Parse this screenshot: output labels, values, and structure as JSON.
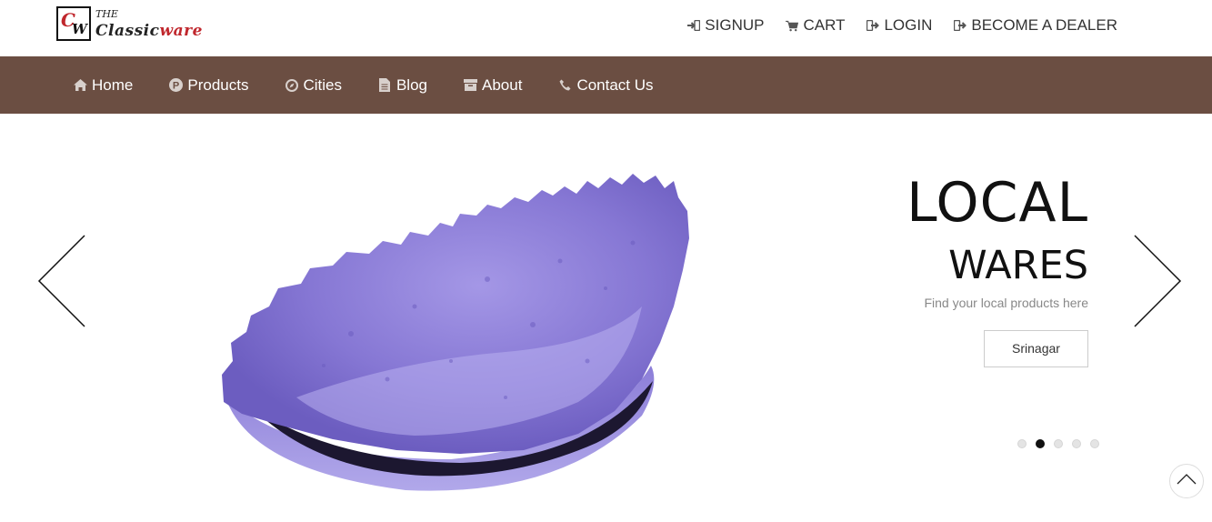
{
  "logo": {
    "mark_c": "C",
    "mark_w": "W",
    "small": "THE",
    "name_dark": "Classic",
    "name_red": "ware"
  },
  "top_links": [
    {
      "label": "SIGNUP",
      "icon": "sign-in-icon"
    },
    {
      "label": "CART",
      "icon": "cart-icon"
    },
    {
      "label": "LOGIN",
      "icon": "login-icon"
    },
    {
      "label": "BECOME A DEALER",
      "icon": "dealer-icon"
    }
  ],
  "nav": [
    {
      "label": "Home",
      "icon": "home-icon"
    },
    {
      "label": "Products",
      "icon": "products-icon"
    },
    {
      "label": "Cities",
      "icon": "compass-icon"
    },
    {
      "label": "Blog",
      "icon": "document-icon"
    },
    {
      "label": "About",
      "icon": "archive-icon"
    },
    {
      "label": "Contact Us",
      "icon": "phone-icon"
    }
  ],
  "slide": {
    "title": "LOCAL",
    "subtitle": "WARES",
    "text": "Find your local products here",
    "button": "Srinagar",
    "active_dot": 1,
    "dot_count": 5
  },
  "colors": {
    "nav_bg": "#6b4e42",
    "brand_red": "#c0272d",
    "bowl": "#8a7ad6"
  }
}
